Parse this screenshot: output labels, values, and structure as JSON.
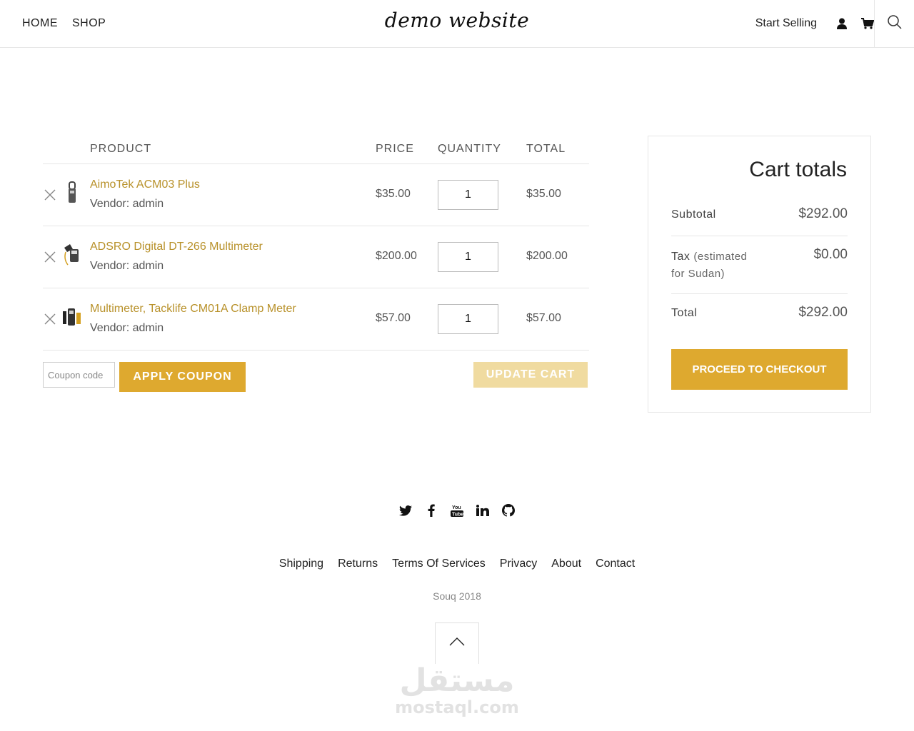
{
  "header": {
    "nav": [
      "HOME",
      "SHOP"
    ],
    "logo": "demo website",
    "start_selling": "Start Selling"
  },
  "cart": {
    "headers": {
      "product": "PRODUCT",
      "price": "PRICE",
      "quantity": "QUANTITY",
      "total": "TOTAL"
    },
    "items": [
      {
        "name": "AimoTek ACM03 Plus",
        "vendor": "Vendor: admin",
        "price": "$35.00",
        "qty": "1",
        "total": "$35.00"
      },
      {
        "name": "ADSRO Digital DT-266 Multimeter",
        "vendor": "Vendor: admin",
        "price": "$200.00",
        "qty": "1",
        "total": "$200.00"
      },
      {
        "name": "Multimeter, Tacklife CM01A Clamp Meter",
        "vendor": "Vendor: admin",
        "price": "$57.00",
        "qty": "1",
        "total": "$57.00"
      }
    ],
    "coupon_placeholder": "Coupon code",
    "apply_coupon": "APPLY COUPON",
    "update_cart": "UPDATE CART"
  },
  "totals": {
    "title": "Cart totals",
    "subtotal_label": "Subtotal",
    "subtotal_value": "$292.00",
    "tax_label": "Tax",
    "tax_note_1": "(estimated",
    "tax_note_2": "for Sudan)",
    "tax_value": "$0.00",
    "total_label": "Total",
    "total_value": "$292.00",
    "checkout": "PROCEED TO CHECKOUT"
  },
  "footer": {
    "social": [
      "twitter-icon",
      "facebook-icon",
      "youtube-icon",
      "linkedin-icon",
      "github-icon"
    ],
    "links": [
      "Shipping",
      "Returns",
      "Terms Of Services",
      "Privacy",
      "About",
      "Contact"
    ],
    "copyright": "Souq 2018",
    "watermark_ar": "مستقل",
    "watermark_en": "mostaql.com"
  },
  "colors": {
    "accent": "#dea92f",
    "accent_light": "#f0dba0",
    "link": "#b8912a"
  }
}
